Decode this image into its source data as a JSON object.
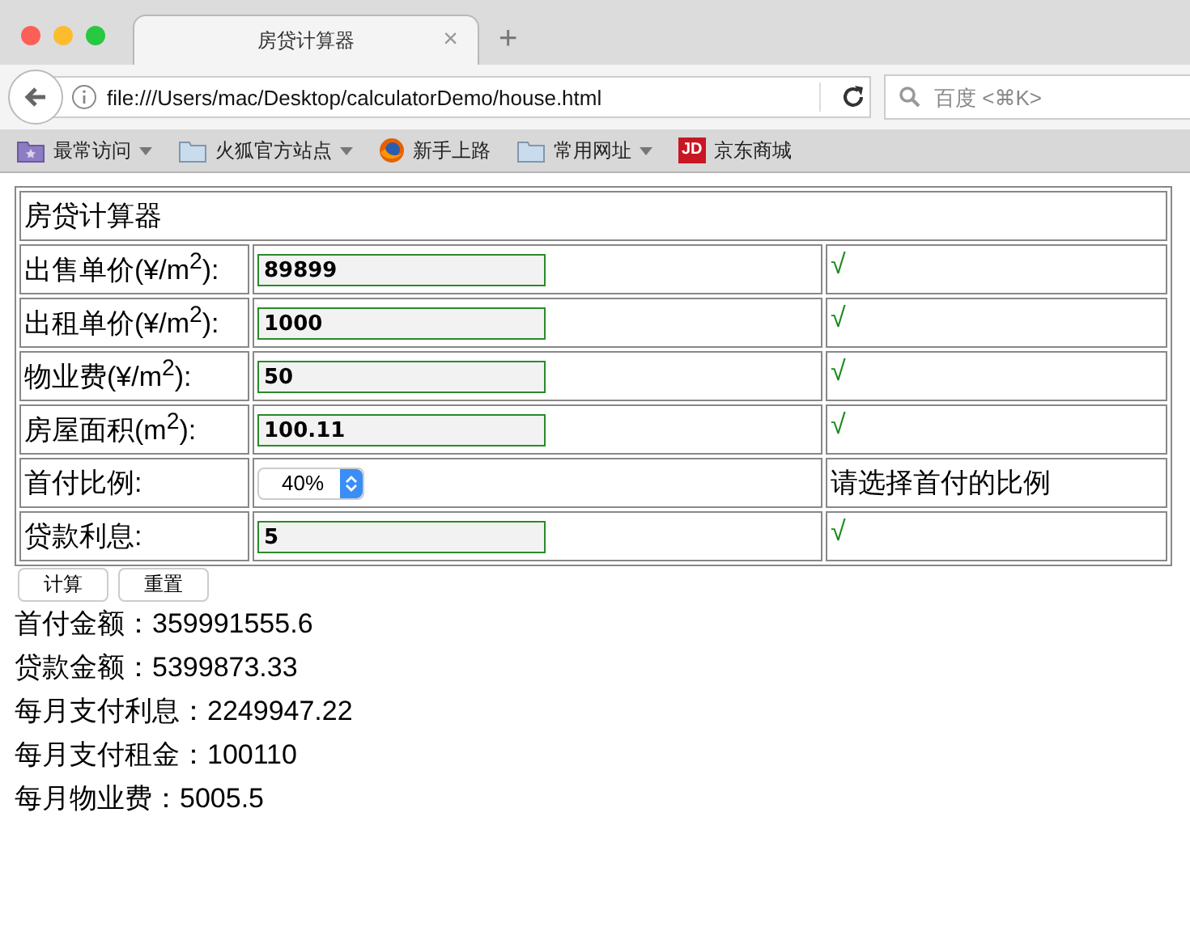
{
  "window": {
    "tab_title": "房贷计算器",
    "tab_close": "×",
    "new_tab": "+"
  },
  "toolbar": {
    "url": "file:///Users/mac/Desktop/calculatorDemo/house.html",
    "search_placeholder": "百度 <⌘K>"
  },
  "bookmarks": [
    {
      "label": "最常访问",
      "kind": "smart",
      "dropdown": true
    },
    {
      "label": "火狐官方站点",
      "kind": "folder",
      "dropdown": true
    },
    {
      "label": "新手上路",
      "kind": "globe",
      "dropdown": false
    },
    {
      "label": "常用网址",
      "kind": "folder",
      "dropdown": true
    },
    {
      "label": "京东商城",
      "kind": "jd",
      "dropdown": false,
      "badge": "JD"
    }
  ],
  "form": {
    "title": "房贷计算器",
    "rows": [
      {
        "label": "出售单价(¥/m$^{2}$):",
        "kind": "input",
        "value": "89899",
        "status": "√",
        "valid": true
      },
      {
        "label": "出租单价(¥/m$^{2}$):",
        "kind": "input",
        "value": "1000",
        "status": "√",
        "valid": true
      },
      {
        "label": "物业费(¥/m$^{2}$):",
        "kind": "input",
        "value": "50",
        "status": "√",
        "valid": true
      },
      {
        "label": "房屋面积(m$^{2}$):",
        "kind": "input",
        "value": "100.11",
        "status": "√",
        "valid": true
      },
      {
        "label": "首付比例:",
        "kind": "select",
        "value": "40%",
        "status": "请选择首付的比例",
        "valid": false
      },
      {
        "label": "贷款利息:",
        "kind": "input",
        "value": "5",
        "status": "√",
        "valid": true
      }
    ],
    "buttons": [
      "计算",
      "重置"
    ]
  },
  "results": [
    "首付金额：359991555.6",
    "贷款金额：5399873.33",
    "每月支付利息：2249947.22",
    "每月支付租金：100110",
    "每月物业费：5005.5"
  ]
}
